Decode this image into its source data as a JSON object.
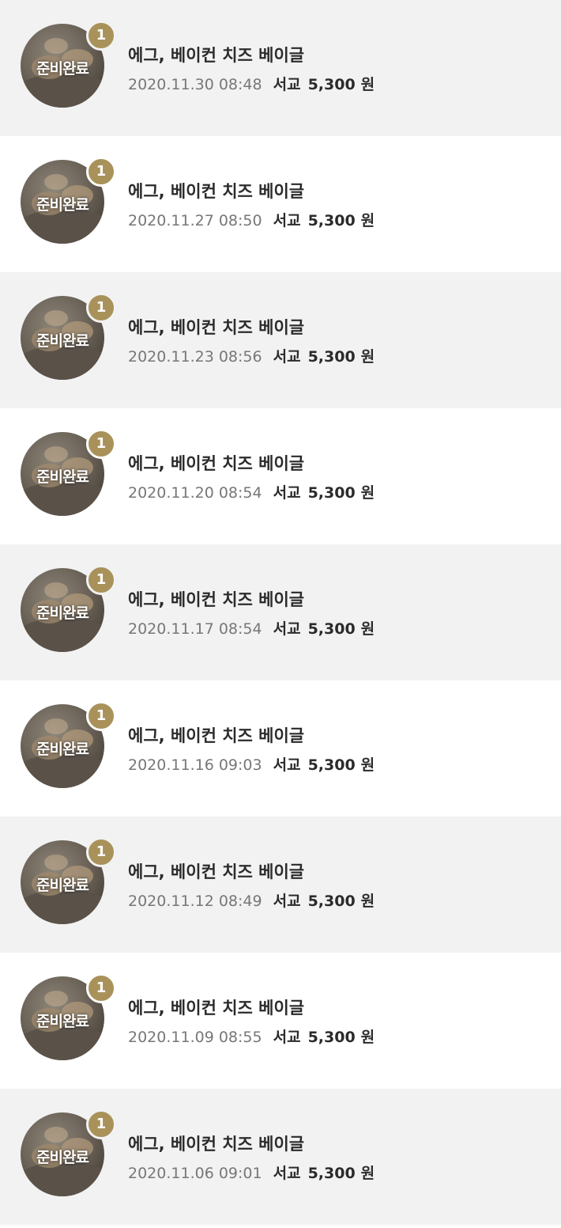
{
  "colors": {
    "shaded_row": "#f2f2f2",
    "plain_row": "#ffffff",
    "badge": "#a9925a",
    "date_text": "#777777",
    "primary_text": "#2b2b2b"
  },
  "orders": [
    {
      "status": "준비완료",
      "qty": "1",
      "item": "에그, 베이컨 치즈 베이글",
      "date": "2020.11.30 08:48",
      "store": "서교",
      "price": "5,300",
      "currency": "원"
    },
    {
      "status": "준비완료",
      "qty": "1",
      "item": "에그, 베이컨 치즈 베이글",
      "date": "2020.11.27 08:50",
      "store": "서교",
      "price": "5,300",
      "currency": "원"
    },
    {
      "status": "준비완료",
      "qty": "1",
      "item": "에그, 베이컨 치즈 베이글",
      "date": "2020.11.23 08:56",
      "store": "서교",
      "price": "5,300",
      "currency": "원"
    },
    {
      "status": "준비완료",
      "qty": "1",
      "item": "에그, 베이컨 치즈 베이글",
      "date": "2020.11.20 08:54",
      "store": "서교",
      "price": "5,300",
      "currency": "원"
    },
    {
      "status": "준비완료",
      "qty": "1",
      "item": "에그, 베이컨 치즈 베이글",
      "date": "2020.11.17 08:54",
      "store": "서교",
      "price": "5,300",
      "currency": "원"
    },
    {
      "status": "준비완료",
      "qty": "1",
      "item": "에그, 베이컨 치즈 베이글",
      "date": "2020.11.16 09:03",
      "store": "서교",
      "price": "5,300",
      "currency": "원"
    },
    {
      "status": "준비완료",
      "qty": "1",
      "item": "에그, 베이컨 치즈 베이글",
      "date": "2020.11.12 08:49",
      "store": "서교",
      "price": "5,300",
      "currency": "원"
    },
    {
      "status": "준비완료",
      "qty": "1",
      "item": "에그, 베이컨 치즈 베이글",
      "date": "2020.11.09 08:55",
      "store": "서교",
      "price": "5,300",
      "currency": "원"
    },
    {
      "status": "준비완료",
      "qty": "1",
      "item": "에그, 베이컨 치즈 베이글",
      "date": "2020.11.06 09:01",
      "store": "서교",
      "price": "5,300",
      "currency": "원"
    }
  ]
}
